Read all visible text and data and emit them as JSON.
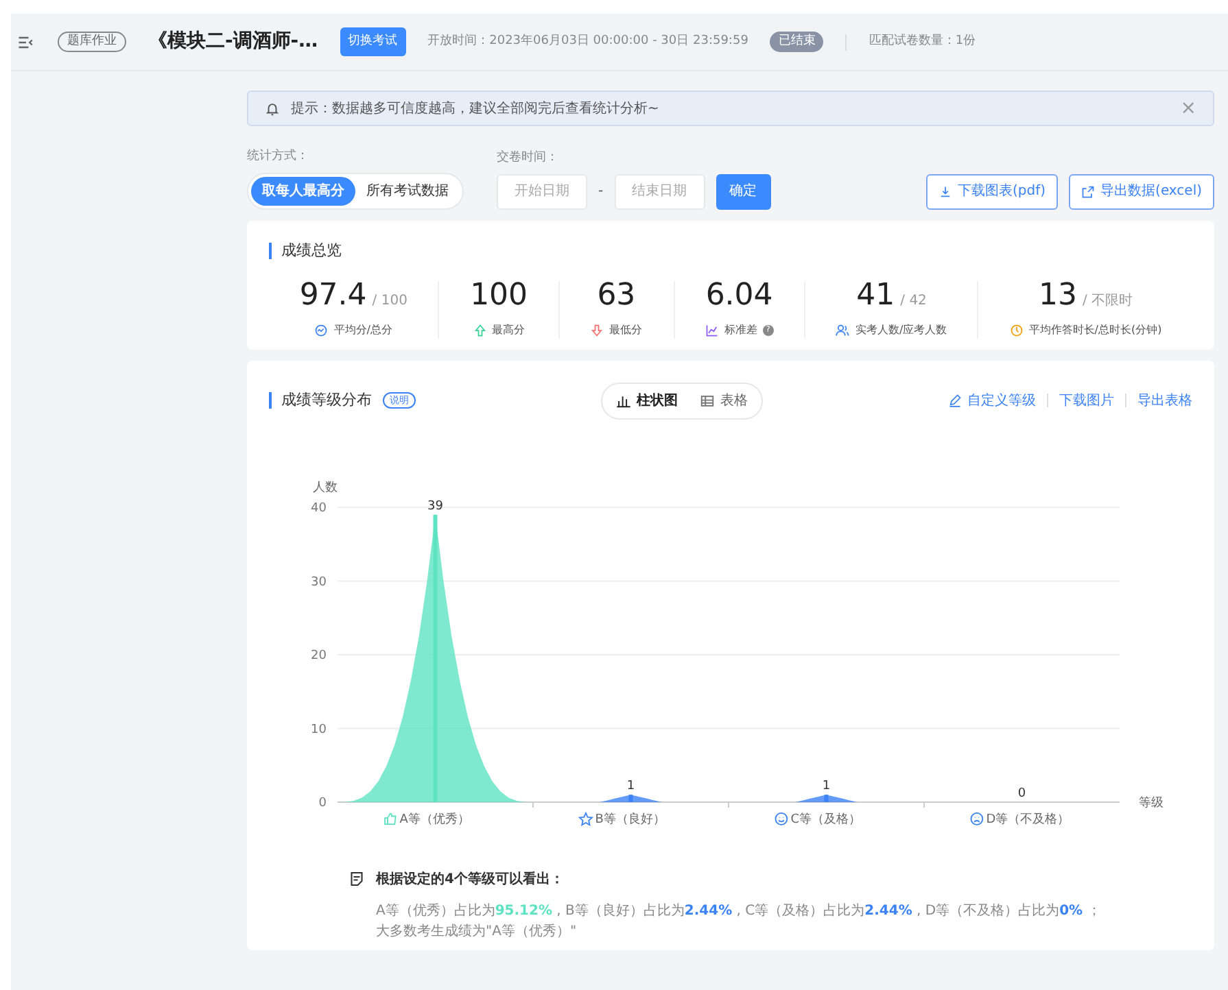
{
  "header": {
    "tag": "题库作业",
    "title": "《模块二-调酒师-…",
    "switch_button": "切换考试",
    "open_time": "开放时间：2023年06月03日 00:00:00 - 30日 23:59:59",
    "status": "已结束",
    "paper_count": "匹配试卷数量：1份"
  },
  "notice": {
    "text": "提示：数据越多可信度越高，建议全部阅完后查看统计分析~",
    "close": "×"
  },
  "filters": {
    "mode_label": "统计方式：",
    "modes": [
      {
        "label": "取每人最高分",
        "selected": true
      },
      {
        "label": "所有考试数据",
        "selected": false
      }
    ],
    "time_label": "交卷时间：",
    "start_placeholder": "开始日期",
    "separator": "-",
    "end_placeholder": "结束日期",
    "confirm": "确定",
    "actions": [
      {
        "label": "下载图表(pdf)",
        "kind": "download"
      },
      {
        "label": "导出数据(excel)",
        "kind": "export"
      }
    ]
  },
  "overview": {
    "title": "成绩总览",
    "stats": [
      {
        "value": "97.4",
        "total": "/ 100",
        "label": "平均分/总分",
        "kind": "average",
        "color": "#3b82f6"
      },
      {
        "value": "100",
        "label": "最高分",
        "kind": "up",
        "color": "#34d399"
      },
      {
        "value": "63",
        "label": "最低分",
        "kind": "down",
        "color": "#f87171"
      },
      {
        "value": "6.04",
        "label": "标准差",
        "kind": "chart",
        "color": "#8b5cf6",
        "help": "?"
      },
      {
        "value": "41",
        "total": "/ 42",
        "label": "实考人数/应考人数",
        "kind": "people",
        "color": "#3b82f6"
      },
      {
        "value": "13",
        "total": "/ 不限时",
        "label": "平均作答时长/总时长(分钟)",
        "kind": "clock",
        "color": "#f59e0b"
      }
    ]
  },
  "distribution": {
    "title": "成绩等级分布",
    "explain": "说明",
    "views": [
      {
        "label": "柱状图",
        "kind": "bar",
        "selected": true
      },
      {
        "label": "表格",
        "kind": "table",
        "selected": false
      }
    ],
    "links": [
      {
        "label": "自定义等级",
        "kind": "edit"
      },
      {
        "label": "下载图片",
        "kind": "plain"
      },
      {
        "label": "导出表格",
        "kind": "plain"
      }
    ],
    "chart_data": {
      "type": "bar",
      "ylabel": "人数",
      "xlabel": "等级",
      "categories": [
        "A等（优秀）",
        "B等（良好）",
        "C等（及格）",
        "D等（不及格）"
      ],
      "series": [
        {
          "colors": [
            "#5ee3c2",
            "#3b82f6",
            "#3b82f6",
            "#3b82f6"
          ],
          "values": [
            39,
            1,
            1,
            0
          ]
        }
      ],
      "ylim": [
        0,
        40
      ],
      "yticks": [
        0,
        10,
        20,
        30,
        40
      ],
      "grid": true,
      "data_labels": true
    },
    "category_icons": [
      {
        "kind": "thumb",
        "color": "#5ee3c2"
      },
      {
        "kind": "star",
        "color": "#3b82f6"
      },
      {
        "kind": "smile",
        "color": "#3b82f6"
      },
      {
        "kind": "sad",
        "color": "#3b82f6"
      }
    ],
    "summary": {
      "title": "根据设定的4个等级可以看出：",
      "parts": [
        {
          "text": "A等（优秀）占比为",
          "value": "95.12%",
          "color": "#5ee3c2"
        },
        {
          "text": " , B等（良好）占比为",
          "value": "2.44%",
          "color": "#3b82f6"
        },
        {
          "text": " , C等（及格）占比为",
          "value": "2.44%",
          "color": "#3b82f6"
        },
        {
          "text": " , D等（不及格）占比为",
          "value": "0%",
          "color": "#3b82f6"
        }
      ],
      "end": " ；",
      "conclusion": "大多数考生成绩为\"A等（优秀）\""
    }
  }
}
